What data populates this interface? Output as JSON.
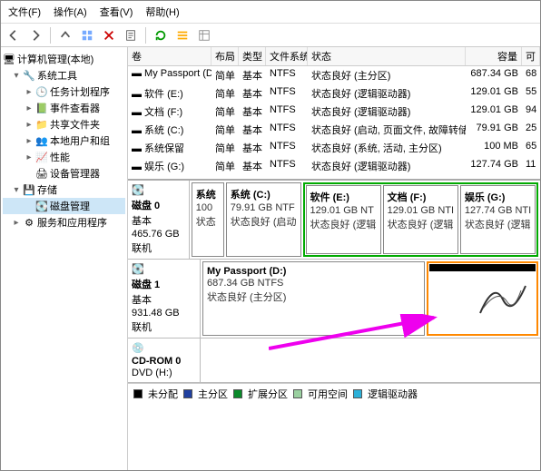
{
  "menu": {
    "file": "文件(F)",
    "action": "操作(A)",
    "view": "查看(V)",
    "help": "帮助(H)"
  },
  "tree": {
    "root": "计算机管理(本地)",
    "sysTools": "系统工具",
    "taskSched": "任务计划程序",
    "eventViewer": "事件查看器",
    "sharedFolders": "共享文件夹",
    "localUsers": "本地用户和组",
    "perf": "性能",
    "devmgr": "设备管理器",
    "storage": "存储",
    "diskmgmt": "磁盘管理",
    "services": "服务和应用程序"
  },
  "cols": {
    "vol": "卷",
    "layout": "布局",
    "type": "类型",
    "fs": "文件系统",
    "status": "状态",
    "capacity": "容量",
    "free": "可"
  },
  "rowPrefix": "▬",
  "volumes": [
    {
      "name": "My Passport (D:)",
      "layout": "简单",
      "type": "基本",
      "fs": "NTFS",
      "status": "状态良好 (主分区)",
      "cap": "687.34 GB",
      "free": "68"
    },
    {
      "name": "软件 (E:)",
      "layout": "简单",
      "type": "基本",
      "fs": "NTFS",
      "status": "状态良好 (逻辑驱动器)",
      "cap": "129.01 GB",
      "free": "55"
    },
    {
      "name": "文档 (F:)",
      "layout": "简单",
      "type": "基本",
      "fs": "NTFS",
      "status": "状态良好 (逻辑驱动器)",
      "cap": "129.01 GB",
      "free": "94"
    },
    {
      "name": "系统 (C:)",
      "layout": "简单",
      "type": "基本",
      "fs": "NTFS",
      "status": "状态良好 (启动, 页面文件, 故障转储, 主分区)",
      "cap": "79.91 GB",
      "free": "25"
    },
    {
      "name": "系统保留",
      "layout": "简单",
      "type": "基本",
      "fs": "NTFS",
      "status": "状态良好 (系统, 活动, 主分区)",
      "cap": "100 MB",
      "free": "65"
    },
    {
      "name": "娱乐 (G:)",
      "layout": "简单",
      "type": "基本",
      "fs": "NTFS",
      "status": "状态良好 (逻辑驱动器)",
      "cap": "127.74 GB",
      "free": "11"
    }
  ],
  "disk0": {
    "title": "磁盘 0",
    "sub1": "基本",
    "sub2": "465.76 GB",
    "sub3": "联机",
    "pSys": {
      "name": "系统",
      "cap": "100",
      "status": "状态"
    },
    "pC": {
      "name": "系统 (C:)",
      "cap": "79.91 GB NTF",
      "status": "状态良好 (启动"
    },
    "pE": {
      "name": "软件 (E:)",
      "cap": "129.01 GB NT",
      "status": "状态良好 (逻辑"
    },
    "pF": {
      "name": "文档 (F:)",
      "cap": "129.01 GB NTI",
      "status": "状态良好 (逻辑"
    },
    "pG": {
      "name": "娱乐 (G:)",
      "cap": "127.74 GB NTI",
      "status": "状态良好 (逻辑"
    }
  },
  "disk1": {
    "title": "磁盘 1",
    "sub1": "基本",
    "sub2": "931.48 GB",
    "sub3": "联机",
    "pD": {
      "name": "My Passport (D:)",
      "cap": "687.34 GB NTFS",
      "status": "状态良好 (主分区)"
    }
  },
  "cdrom": {
    "title": "CD-ROM 0",
    "drive": "DVD (H:)"
  },
  "legend": {
    "unalloc": "未分配",
    "primary": "主分区",
    "extended": "扩展分区",
    "free": "可用空间",
    "logical": "逻辑驱动器"
  },
  "colors": {
    "primary": "#2040a0",
    "logical": "#2cb0d8",
    "extended": "#0a8a2a",
    "unalloc": "#000",
    "free": "#9ad0a0"
  }
}
